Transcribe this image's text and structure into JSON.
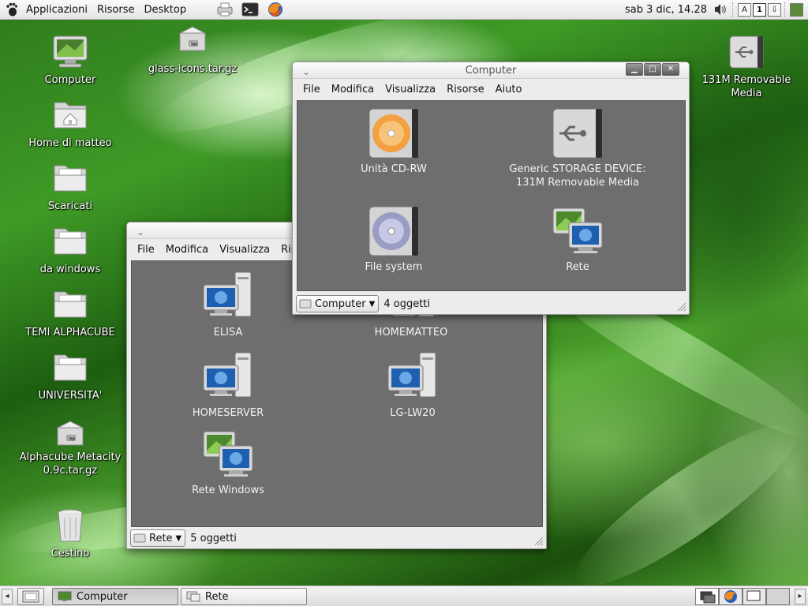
{
  "top_panel": {
    "menus": [
      "Applicazioni",
      "Risorse",
      "Desktop"
    ],
    "clock": "sab  3 dic, 14.28",
    "workspace_number": "1"
  },
  "desktop_icons": [
    {
      "label": "Computer",
      "icon": "computer-icon"
    },
    {
      "label": "glass-icons.tar.gz",
      "icon": "archive-icon"
    },
    {
      "label": "Home di matteo",
      "icon": "home-folder-icon"
    },
    {
      "label": "Scaricati",
      "icon": "folder-icon"
    },
    {
      "label": "da windows",
      "icon": "folder-icon"
    },
    {
      "label": "TEMI ALPHACUBE",
      "icon": "folder-icon"
    },
    {
      "label": "UNIVERSITA'",
      "icon": "folder-icon"
    },
    {
      "label": "Alphacube Metacity 0.9c.tar.gz",
      "icon": "archive-icon"
    },
    {
      "label": "Cestino",
      "icon": "trash-icon"
    },
    {
      "label": "131M Removable Media",
      "icon": "usb-drive-icon"
    }
  ],
  "window_computer": {
    "title": "Computer",
    "menu": [
      "File",
      "Modifica",
      "Visualizza",
      "Risorse",
      "Aiuto"
    ],
    "items": [
      {
        "label": "Unità CD-RW",
        "icon": "cd-drive-icon"
      },
      {
        "label": "Generic STORAGE DEVICE: 131M Removable Media",
        "icon": "usb-drive-icon"
      },
      {
        "label": "File system",
        "icon": "harddisk-icon"
      },
      {
        "label": "Rete",
        "icon": "network-icon"
      }
    ],
    "location": "Computer",
    "status": "4 oggetti"
  },
  "window_rete": {
    "title": "Rete",
    "menu": [
      "File",
      "Modifica",
      "Visualizza",
      "Ris"
    ],
    "items": [
      {
        "label": "ELISA",
        "icon": "workstation-icon"
      },
      {
        "label": "HOMEMATTEO",
        "icon": "workstation-icon"
      },
      {
        "label": "HOMESERVER",
        "icon": "workstation-icon"
      },
      {
        "label": "LG-LW20",
        "icon": "workstation-icon"
      },
      {
        "label": "Rete Windows",
        "icon": "network-icon"
      }
    ],
    "location": "Rete",
    "status": "5 oggetti"
  },
  "taskbar": {
    "tasks": [
      "Computer",
      "Rete"
    ],
    "active_task": "Computer"
  }
}
